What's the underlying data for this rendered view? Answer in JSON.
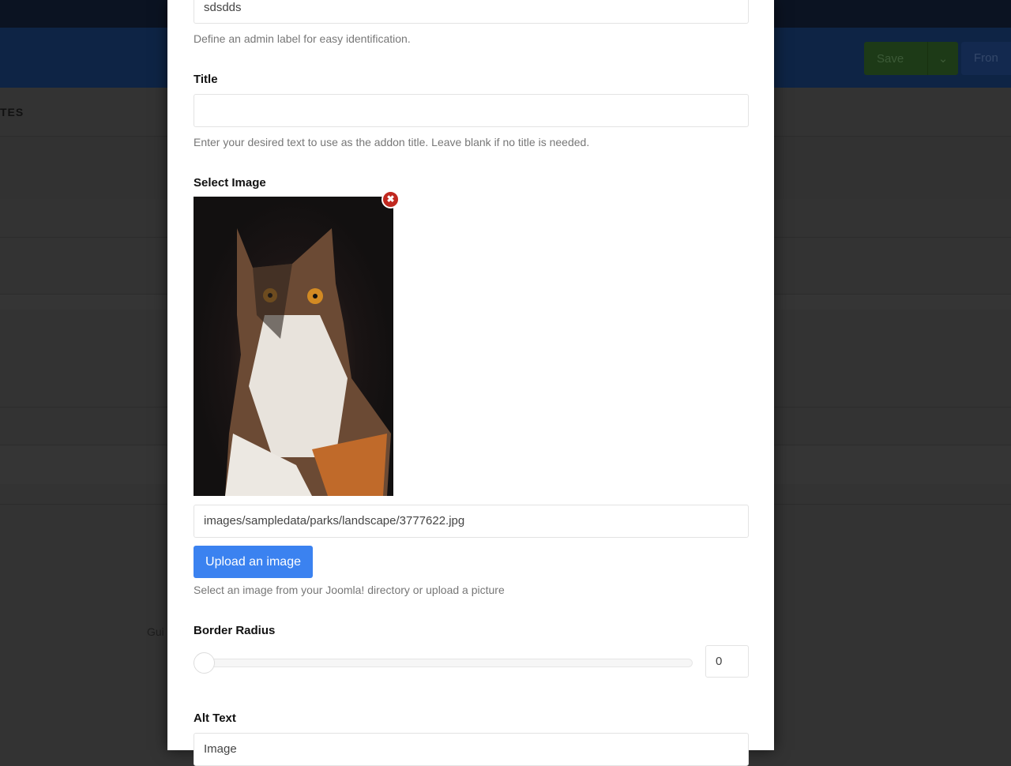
{
  "background": {
    "section_heading": "TES",
    "save_button": "Save",
    "frontend_button": "Fron",
    "guide_text": "Gui"
  },
  "form": {
    "admin_label": {
      "value": "sdsdds",
      "help": "Define an admin label for easy identification."
    },
    "title": {
      "label": "Title",
      "value": "",
      "help": "Enter your desired text to use as the addon title. Leave blank if no title is needed."
    },
    "select_image": {
      "label": "Select Image",
      "path": "images/sampledata/parks/landscape/3777622.jpg",
      "upload_label": "Upload an image",
      "help": "Select an image from your Joomla! directory or upload a picture",
      "remove_icon": "close-circle-icon"
    },
    "border_radius": {
      "label": "Border Radius",
      "value": "0",
      "slider_value": 0
    },
    "alt_text": {
      "label": "Alt Text",
      "value": "Image"
    }
  },
  "colors": {
    "upload_button": "#3b82f0",
    "remove_badge": "#c0281f"
  }
}
